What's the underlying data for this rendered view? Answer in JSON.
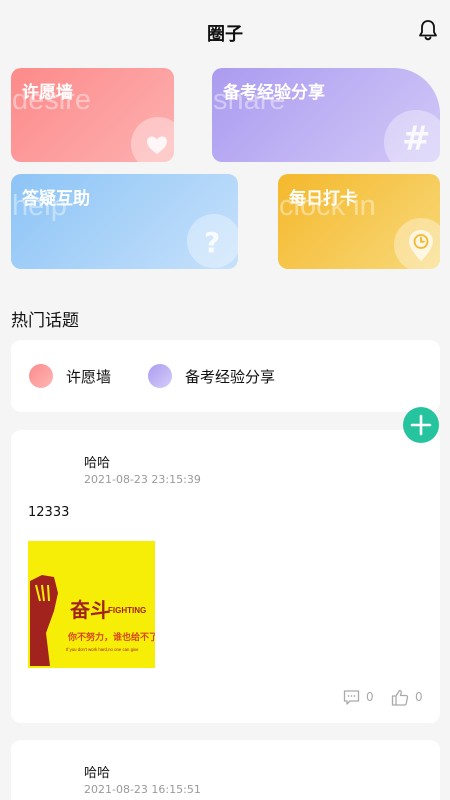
{
  "header": {
    "title": "圈子"
  },
  "categories": [
    {
      "label": "许愿墙",
      "ghost": "desire",
      "icon": "heart-icon"
    },
    {
      "label": "备考经验分享",
      "ghost": "share",
      "icon": "hash-icon"
    },
    {
      "label": "答疑互助",
      "ghost": "help",
      "icon": "question-icon"
    },
    {
      "label": "每日打卡",
      "ghost": "clock in",
      "icon": "clock-pin-icon"
    }
  ],
  "hot_topics": {
    "title": "热门话题",
    "items": [
      {
        "label": "许愿墙",
        "color": "#fd8a8a"
      },
      {
        "label": "备考经验分享",
        "color": "#ab9bf0"
      }
    ]
  },
  "fab": {
    "icon": "plus-icon",
    "color": "#25c49e"
  },
  "posts": [
    {
      "author": "哈哈",
      "time": "2021-08-23 23:15:39",
      "content": "12333",
      "image": {
        "big": "奋斗",
        "en": "FIGHTING",
        "line1": "你不努力，谁也给不了你",
        "line2": "If you don't work hard,no one can give"
      },
      "comments": "0",
      "likes": "0"
    },
    {
      "author": "哈哈",
      "time": "2021-08-23 16:15:51"
    }
  ]
}
